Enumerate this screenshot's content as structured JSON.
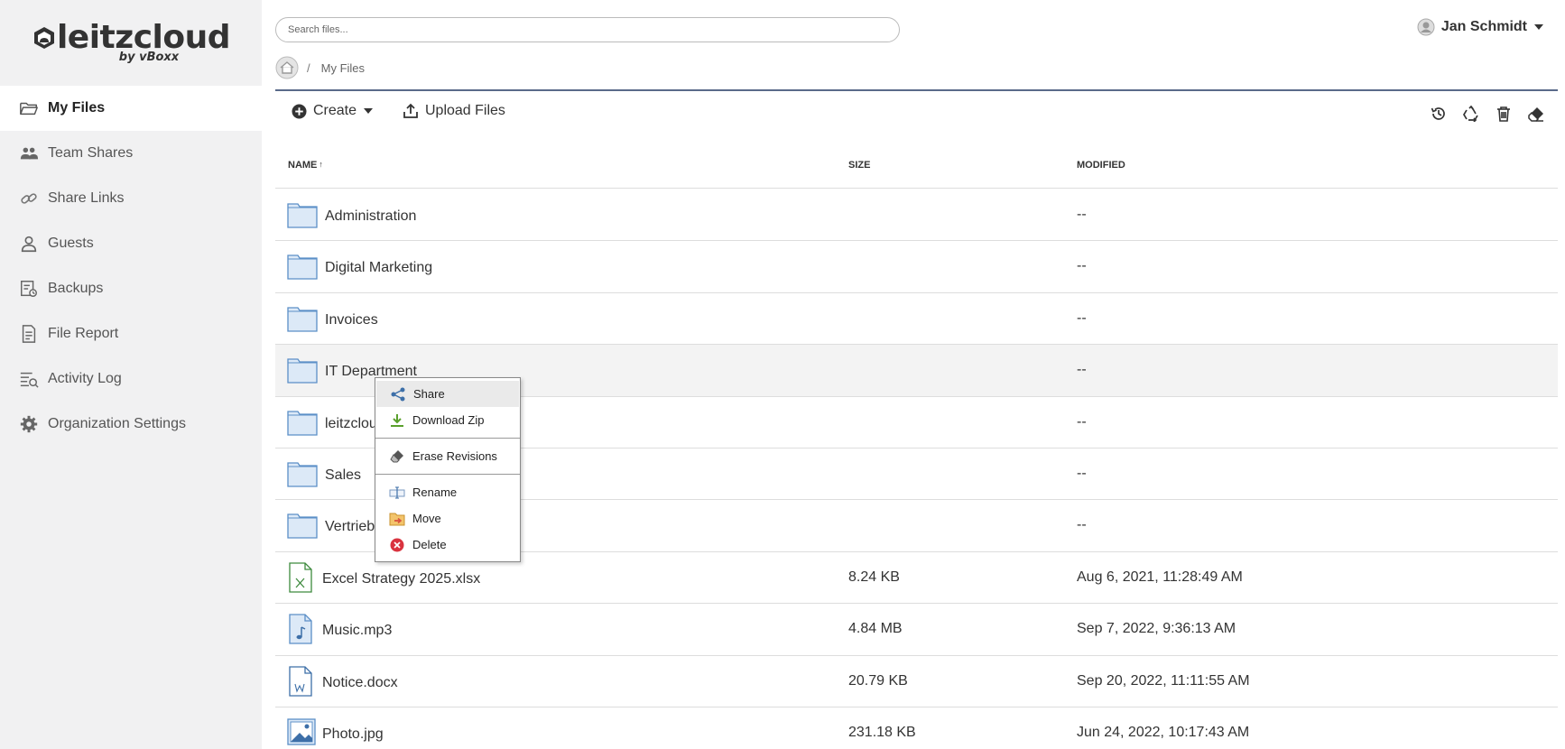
{
  "brand": {
    "name": "leitzcloud",
    "sub": "by vBoxx"
  },
  "sidebar": {
    "items": [
      {
        "label": "My Files",
        "icon": "folder-open-icon",
        "active": true
      },
      {
        "label": "Team Shares",
        "icon": "users-icon"
      },
      {
        "label": "Share Links",
        "icon": "link-icon"
      },
      {
        "label": "Guests",
        "icon": "user-icon"
      },
      {
        "label": "Backups",
        "icon": "backup-icon"
      },
      {
        "label": "File Report",
        "icon": "file-report-icon"
      },
      {
        "label": "Activity Log",
        "icon": "activity-list-icon"
      },
      {
        "label": "Organization Settings",
        "icon": "gear-icon"
      }
    ]
  },
  "search": {
    "placeholder": "Search files..."
  },
  "user": {
    "name": "Jan Schmidt"
  },
  "breadcrumb": {
    "current": "My Files",
    "separator": "/"
  },
  "toolbar": {
    "create_label": "Create",
    "upload_label": "Upload Files",
    "icons": [
      "history-icon",
      "recycle-icon",
      "trash-icon",
      "eraser-icon"
    ]
  },
  "table": {
    "headers": {
      "name": "NAME",
      "sort_indicator": "↑",
      "size": "SIZE",
      "modified": "MODIFIED"
    },
    "rows": [
      {
        "name": "Administration",
        "type": "folder",
        "size": "",
        "modified": "--"
      },
      {
        "name": "Digital Marketing",
        "type": "folder",
        "size": "",
        "modified": "--"
      },
      {
        "name": "Invoices",
        "type": "folder",
        "size": "",
        "modified": "--"
      },
      {
        "name": "IT Department",
        "type": "folder",
        "size": "",
        "modified": "--"
      },
      {
        "name": "leitzcloud",
        "type": "folder",
        "size": "",
        "modified": "--"
      },
      {
        "name": "Sales",
        "type": "folder",
        "size": "",
        "modified": "--"
      },
      {
        "name": "Vertrieb",
        "type": "folder",
        "size": "",
        "modified": "--"
      },
      {
        "name": "Excel Strategy 2025.xlsx",
        "type": "excel",
        "size": "8.24 KB",
        "modified": "Aug 6, 2021, 11:28:49 AM"
      },
      {
        "name": "Music.mp3",
        "type": "audio",
        "size": "4.84 MB",
        "modified": "Sep 7, 2022, 9:36:13 AM"
      },
      {
        "name": "Notice.docx",
        "type": "word",
        "size": "20.79 KB",
        "modified": "Sep 20, 2022, 11:11:55 AM"
      },
      {
        "name": "Photo.jpg",
        "type": "image",
        "size": "231.18 KB",
        "modified": "Jun 24, 2022, 10:17:43 AM"
      }
    ]
  },
  "context_menu": {
    "items": [
      {
        "label": "Share",
        "icon": "share-icon"
      },
      {
        "label": "Download Zip",
        "icon": "download-icon"
      },
      {
        "label": "Erase Revisions",
        "icon": "eraser-icon"
      },
      {
        "label": "Rename",
        "icon": "rename-icon"
      },
      {
        "label": "Move",
        "icon": "move-folder-icon"
      },
      {
        "label": "Delete",
        "icon": "delete-icon"
      }
    ]
  },
  "colors": {
    "accent": "#5a6a8a",
    "folder_fill": "#dce9f7",
    "folder_stroke": "#5b8fc7",
    "delete": "#d9333f",
    "download": "#5aa02c"
  }
}
